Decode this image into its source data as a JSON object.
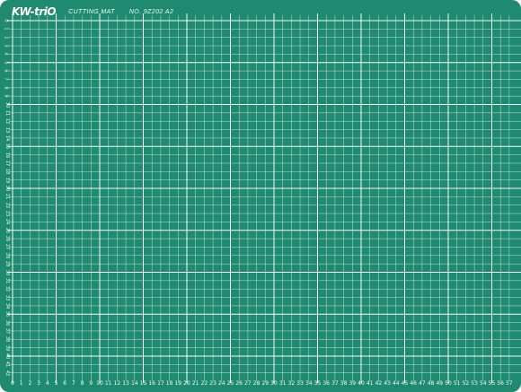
{
  "mat": {
    "brand": "KW-triO",
    "product": "CUTTING MAT",
    "model": "NO. 9Z202   A2",
    "colors": {
      "mat": "#1f8a6f",
      "line": "#cfeee4",
      "major_line": "#f2fffa",
      "text": "#e9fff6"
    }
  },
  "scales": {
    "x_labels": [
      "0",
      "1",
      "2",
      "3",
      "4",
      "5",
      "6",
      "7",
      "8",
      "9",
      "10",
      "11",
      "12",
      "13",
      "14",
      "15",
      "16",
      "17",
      "18",
      "19",
      "20",
      "21",
      "22",
      "23",
      "24",
      "25",
      "26",
      "27",
      "28",
      "29",
      "30",
      "31",
      "32",
      "33",
      "34",
      "35",
      "36",
      "37",
      "38",
      "39",
      "40",
      "41",
      "42",
      "43",
      "44",
      "45",
      "46",
      "47",
      "48",
      "49",
      "50",
      "51",
      "52",
      "53",
      "54",
      "55",
      "56",
      "57"
    ],
    "y_labels": [
      "0",
      "1",
      "2",
      "3",
      "4",
      "5",
      "6",
      "7",
      "8",
      "9",
      "10",
      "11",
      "12",
      "13",
      "14",
      "15",
      "16",
      "17",
      "18",
      "19",
      "20",
      "21",
      "22",
      "23",
      "24",
      "25",
      "26",
      "27",
      "28",
      "29",
      "30",
      "31",
      "32",
      "33",
      "34",
      "35",
      "36",
      "37",
      "38",
      "39",
      "40",
      "41",
      "42"
    ],
    "major_every": 5
  }
}
